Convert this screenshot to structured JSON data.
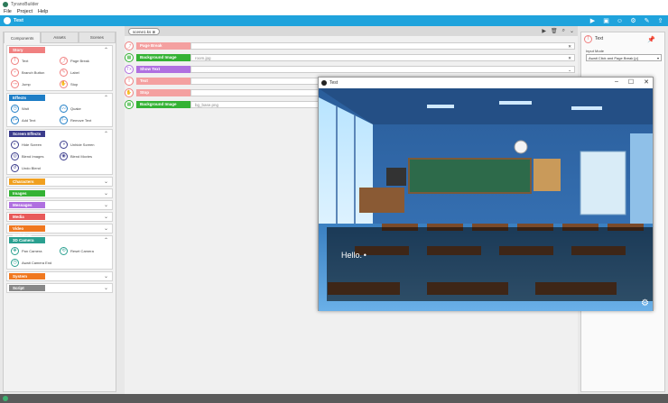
{
  "app": {
    "title": "TyranoBuilder",
    "menu": [
      "File",
      "Project",
      "Help"
    ]
  },
  "project": {
    "name": "Test"
  },
  "left_tabs": [
    "Components",
    "Assets",
    "Scenes"
  ],
  "categories": [
    {
      "label": "Story",
      "color": "#f08080",
      "expanded": true,
      "items": [
        {
          "label": "Text",
          "icon": "text-icon",
          "glyph": "T"
        },
        {
          "label": "Page Break",
          "icon": "page-break-icon",
          "glyph": "⤴"
        },
        {
          "label": "Branch Button",
          "icon": "branch-icon",
          "glyph": "⑂"
        },
        {
          "label": "Label",
          "icon": "label-icon",
          "glyph": "✎"
        },
        {
          "label": "Jump",
          "icon": "jump-icon",
          "glyph": "↝"
        },
        {
          "label": "Stop",
          "icon": "stop-icon",
          "glyph": "✋"
        }
      ]
    },
    {
      "label": "Effects",
      "color": "#1f7ec6",
      "expanded": true,
      "items": [
        {
          "label": "Wait",
          "icon": "wait-icon",
          "glyph": "◷"
        },
        {
          "label": "Quake",
          "icon": "quake-icon",
          "glyph": "〰"
        },
        {
          "label": "Add Text",
          "icon": "add-text-icon",
          "glyph": "T+"
        },
        {
          "label": "Remove Text",
          "icon": "remove-text-icon",
          "glyph": "T−"
        }
      ]
    },
    {
      "label": "Screen Effects",
      "color": "#3b3c8c",
      "expanded": true,
      "items": [
        {
          "label": "Hide Screen",
          "icon": "hide-screen-icon",
          "glyph": "◐"
        },
        {
          "label": "Unhide Screen",
          "icon": "unhide-screen-icon",
          "glyph": "◑"
        },
        {
          "label": "Blend Images",
          "icon": "blend-images-icon",
          "glyph": "◎"
        },
        {
          "label": "Blend Movies",
          "icon": "blend-movies-icon",
          "glyph": "◉"
        },
        {
          "label": "Undo Blend",
          "icon": "undo-blend-icon",
          "glyph": "↺"
        }
      ]
    },
    {
      "label": "Characters",
      "color": "#f0a020",
      "expanded": false,
      "items": []
    },
    {
      "label": "Images",
      "color": "#34b234",
      "expanded": false,
      "items": []
    },
    {
      "label": "Messages",
      "color": "#b070e0",
      "expanded": false,
      "items": []
    },
    {
      "label": "Media",
      "color": "#e85a5a",
      "expanded": false,
      "items": []
    },
    {
      "label": "Video Backdrop",
      "color": "#f07820",
      "expanded": false,
      "items": []
    },
    {
      "label": "3D Camera",
      "color": "#2aa090",
      "expanded": true,
      "items": [
        {
          "label": "Pan Camera",
          "icon": "pan-camera-icon",
          "glyph": "✥"
        },
        {
          "label": "Reset Camera",
          "icon": "reset-camera-icon",
          "glyph": "⟲"
        },
        {
          "label": "Await Camera End",
          "icon": "await-camera-icon",
          "glyph": "◷"
        }
      ]
    },
    {
      "label": "System",
      "color": "#f07820",
      "expanded": false,
      "items": []
    },
    {
      "label": "Script",
      "color": "#888888",
      "expanded": false,
      "items": []
    }
  ],
  "script_tab": {
    "name": "scene1.ks"
  },
  "commands": [
    {
      "label": "Page Break",
      "color": "#f4a0a0",
      "icon_color": "#f08080",
      "glyph": "⤴",
      "value": "",
      "has_field": false,
      "control": ""
    },
    {
      "label": "Background Image",
      "color": "#34b234",
      "icon_color": "#34b234",
      "glyph": "▦",
      "value": "room.jpg",
      "has_field": true,
      "control": "x"
    },
    {
      "label": "Show Text",
      "color": "#b070e0",
      "icon_color": "#b070e0",
      "glyph": "Tx",
      "value": "",
      "has_field": true,
      "control": "dd"
    },
    {
      "label": "Text",
      "color": "#f4a0a0",
      "icon_color": "#f08080",
      "glyph": "T",
      "value": "",
      "has_field": false,
      "control": ""
    },
    {
      "label": "Stop",
      "color": "#f4a0a0",
      "icon_color": "#f08080",
      "glyph": "✋",
      "value": "",
      "has_field": false,
      "control": ""
    },
    {
      "label": "Background Image",
      "color": "#34b234",
      "icon_color": "#34b234",
      "glyph": "▦",
      "value": "bg_base.png",
      "has_field": true,
      "control": ""
    }
  ],
  "inspector": {
    "title": "Text",
    "input_mode_label": "Input Mode",
    "input_mode_value": "Await Click and Page Break [p]"
  },
  "preview": {
    "title": "Test",
    "message": "Hello. •"
  }
}
